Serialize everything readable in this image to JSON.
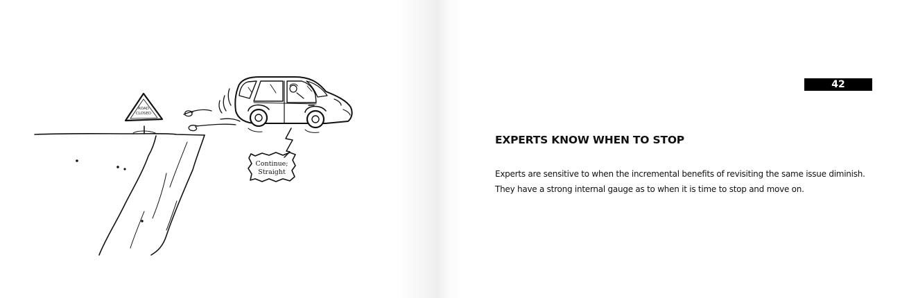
{
  "left_page": {
    "illustration": {
      "road_sign": {
        "line1": "ROAD",
        "line2": "CLOSED"
      },
      "speech_bubble": {
        "line1": "Continue;",
        "line2": "Straight"
      }
    }
  },
  "right_page": {
    "page_number": "42",
    "title": "EXPERTS KNOW WHEN TO STOP",
    "body": "Experts are sensitive to when the incremental benefits of revisiting the same issue diminish. They have a strong internal gauge as to when it is time to stop and move on."
  }
}
